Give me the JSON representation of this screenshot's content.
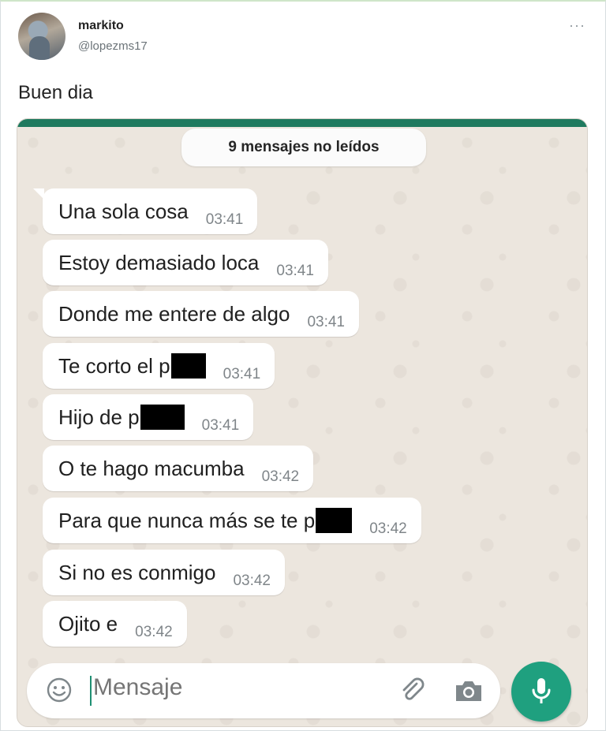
{
  "tweet": {
    "user_name": "markito",
    "user_handle": "@lopezms17",
    "more_label": "···",
    "text": "Buen dia"
  },
  "chat": {
    "unread_banner": "9 mensajes no leídos",
    "messages": [
      {
        "text": "Una sola cosa",
        "time": "03:41"
      },
      {
        "text": "Estoy demasiado loca",
        "time": "03:41"
      },
      {
        "text": "Donde me entere de algo",
        "time": "03:41"
      },
      {
        "text": "Te corto el p",
        "time": "03:41"
      },
      {
        "text": "Hijo de p",
        "time": "03:41"
      },
      {
        "text": "O te hago macumba",
        "time": "03:42"
      },
      {
        "text": "Para que nunca más se te p",
        "time": "03:42"
      },
      {
        "text": "Si no es conmigo",
        "time": "03:42"
      },
      {
        "text": "Ojito e",
        "time": "03:42"
      }
    ],
    "input_placeholder": "Mensaje",
    "icons": {
      "emoji": "emoji-icon",
      "attach": "paperclip-icon",
      "camera": "camera-icon",
      "mic": "microphone-icon"
    },
    "colors": {
      "accent": "#1fa07f",
      "bubble": "#ffffff",
      "background": "#ece6de"
    }
  }
}
